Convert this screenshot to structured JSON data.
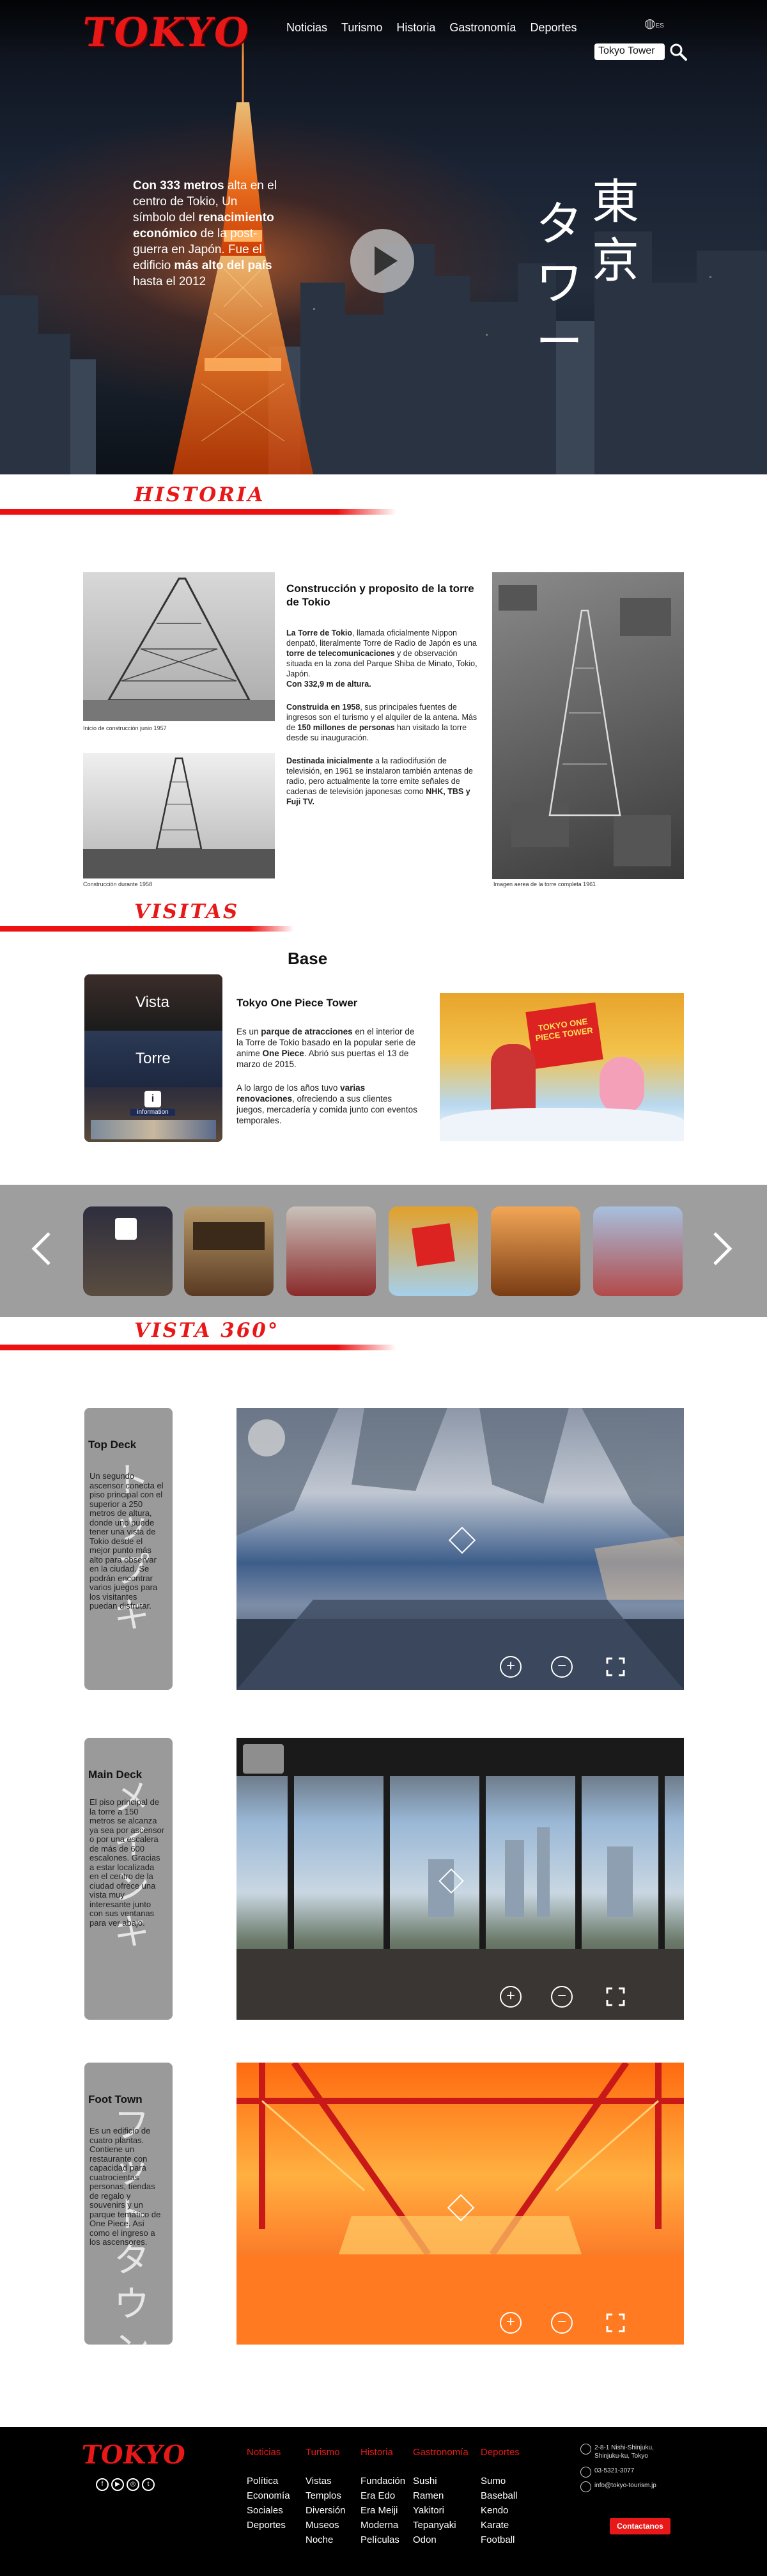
{
  "header": {
    "logo": "TOKYO",
    "nav": [
      "Noticias",
      "Turismo",
      "Historia",
      "Gastronomía",
      "Deportes"
    ],
    "language": "ES",
    "search_value": "Tokyo Tower"
  },
  "hero": {
    "text_parts": [
      "Con 333 metros",
      " alta en el centro de Tokio, Un símbolo del ",
      "renacimiento económico",
      " de la post-guerra en Japón. Fue el edificio ",
      "más alto del país",
      " hasta el 2012"
    ],
    "kana_col1": "タワー",
    "kana_col2": "東京"
  },
  "historia": {
    "title": "HISTORIA",
    "caption_1": "Inicio de construcción junio 1957",
    "caption_2": "Construcción durante 1958",
    "caption_3": "Imagen aerea de la torre completa 1961",
    "heading": "Construcción y proposito de la torre de Tokio",
    "p1_a": "La Torre de Tokio",
    "p1_b": ", llamada oficialmente Nippon denpatō, literalmente Torre de Radio de Japón es una ",
    "p1_c": "torre de telecomunicaciones",
    "p1_d": " y de observación situada en la zona del Parque Shiba de Minato, Tokio, Japón.",
    "p1_e": "Con 332,9 m de altura.",
    "p2_a": "Construida en 1958",
    "p2_b": ", sus principales fuentes de ingresos son el turismo y el alquiler de la antena. Más de ",
    "p2_c": "150 millones de personas",
    "p2_d": " han visitado la torre desde su inauguración.",
    "p3_a": "Destinada inicialmente",
    "p3_b": " a la radiodifusión de televisión, en 1961 se instalaron también antenas de radio, pero actualmente la torre emite señales de cadenas de televisión japonesas como ",
    "p3_c": "NHK, TBS y Fuji TV."
  },
  "visitas": {
    "title": "VISITAS",
    "base": "Base",
    "tab_1": "Vista",
    "tab_2": "Torre",
    "heading": "Tokyo One Piece Tower",
    "p1_a": "Es un ",
    "p1_b": "parque de atracciones",
    "p1_c": " en el interior de la Torre de Tokio basado en la popular serie de anime ",
    "p1_d": "One Piece",
    "p1_e": ". Abrió sus puertas el 13 de marzo de 2015.",
    "p2_a": "A lo largo de los años tuvo ",
    "p2_b": "varias renovaciones",
    "p2_c": ", ofreciendo a sus clientes juegos, mercadería y comida junto con eventos temporales.",
    "poster_text": "TOKYO ONE PIECE TOWER",
    "info_label": "information"
  },
  "vista360": {
    "title": "VISTA 360°",
    "cards": [
      {
        "title": "Top Deck",
        "text": "Un segundo ascensor conecta el piso principal con el superior a 250 metros de altura, donde uno puede tener una vista de Tokio desde el mejor punto más alto para observar en la ciudad. Se podrán encontrar varios juegos para los visitantes puedan disfrutar.",
        "vk": "トップキ"
      },
      {
        "title": "Main Deck",
        "text": "El piso principal de la torre a 150 metros se alcanza ya sea por ascensor o por una escalera de más de 600 escalones. Gracias a estar localizada en el centro de la ciudad ofrece una vista muy interesante junto con sus ventanas para ver abajo.",
        "vk": "メインキ"
      },
      {
        "title": "Foot Town",
        "text": "Es un edificio de cuatro plantas. Contiene un restaurante con capacidad para cuatrocientas personas, tiendas de regalo y souvenirs y un parque temático de One Piece. Así como el ingreso a los ascensores.",
        "vk": "フットタウン"
      }
    ]
  },
  "footer": {
    "logo": "TOKYO",
    "cols": [
      {
        "head": "Noticias",
        "items": [
          "Política",
          "Economía",
          "Sociales",
          "Deportes"
        ]
      },
      {
        "head": "Turismo",
        "items": [
          "Vistas",
          "Templos",
          "Diversión",
          "Museos",
          "Noche"
        ]
      },
      {
        "head": "Historia",
        "items": [
          "Fundación",
          "Era Edo",
          "Era Meiji",
          "Moderna",
          "Películas"
        ]
      },
      {
        "head": "Gastronomía",
        "items": [
          "Sushi",
          "Ramen",
          "Yakitori",
          "Tepanyaki",
          "Odon"
        ]
      },
      {
        "head": "Deportes",
        "items": [
          "Sumo",
          "Baseball",
          "Kendo",
          "Karate",
          "Football"
        ]
      }
    ],
    "address": "2-8-1 Nishi-Shinjuku, Shinjuku-ku, Tokyo",
    "phone": "03-5321-3077",
    "email": "info@tokyo-tourism.jp",
    "contact_button": "Contactanos"
  },
  "colors": {
    "accent": "#e81818",
    "hero_bg": "#1a2333",
    "footer_bg": "#000000",
    "carousel_bg": "#9e9e9e"
  }
}
